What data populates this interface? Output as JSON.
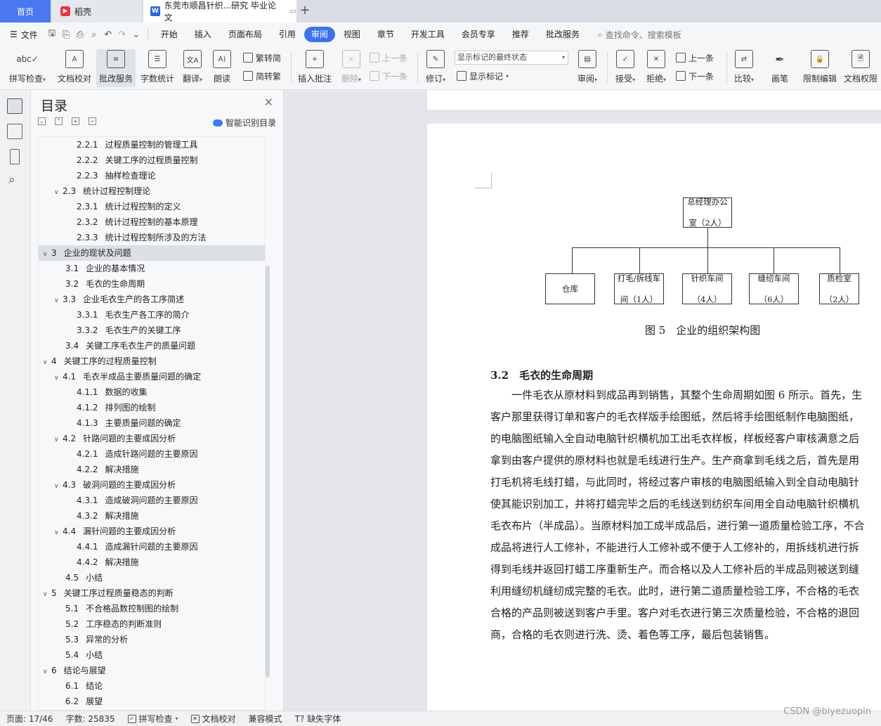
{
  "tabs": {
    "home": "首页",
    "daoke": "稻壳",
    "doc": "东莞市顺昌针织...研究 毕业论文",
    "add": "+"
  },
  "menu": {
    "file": "文件",
    "items": [
      "开始",
      "插入",
      "页面布局",
      "引用",
      "审阅",
      "视图",
      "章节",
      "开发工具",
      "会员专享",
      "推荐",
      "批改服务"
    ],
    "active": "审阅",
    "search": "查找命令、搜索模板"
  },
  "ribbon": {
    "spell": "拼写检查",
    "proofread": "文档校对",
    "correct": "批改服务",
    "wordcount": "字数统计",
    "translate": "翻译",
    "read": "朗读",
    "to_trad": "繁转简",
    "to_simp": "简转繁",
    "insert_comment": "插入批注",
    "delete": "删除",
    "prev": "上一条",
    "next": "下一条",
    "revise": "修订",
    "markup_state": "显示标记的最终状态",
    "show_markup": "显示标记",
    "review": "审阅",
    "accept": "接受",
    "reject": "拒绝",
    "prev2": "上一条",
    "next2": "下一条",
    "compare": "比较",
    "pen": "画笔",
    "restrict": "限制编辑",
    "permission": "文档权限"
  },
  "toc": {
    "title": "目录",
    "smart": "智能识别目录",
    "items": [
      {
        "num": "2.2.1",
        "text": "过程质量控制的管理工具",
        "level": 3,
        "arrow": ""
      },
      {
        "num": "2.2.2",
        "text": "关键工序的过程质量控制",
        "level": 3,
        "arrow": ""
      },
      {
        "num": "2.2.3",
        "text": "抽样检查理论",
        "level": 3,
        "arrow": ""
      },
      {
        "num": "2.3",
        "text": "统计过程控制理论",
        "level": 2,
        "arrow": "∨"
      },
      {
        "num": "2.3.1",
        "text": "统计过程控制的定义",
        "level": 3,
        "arrow": ""
      },
      {
        "num": "2.3.2",
        "text": "统计过程控制的基本原理",
        "level": 3,
        "arrow": ""
      },
      {
        "num": "2.3.3",
        "text": "统计过程控制所涉及的方法",
        "level": 3,
        "arrow": ""
      },
      {
        "num": "3",
        "text": "企业的现状及问题",
        "level": 1,
        "arrow": "∨",
        "selected": true
      },
      {
        "num": "3.1",
        "text": "企业的基本情况",
        "level": 2,
        "arrow": ""
      },
      {
        "num": "3.2",
        "text": "毛衣的生命周期",
        "level": 2,
        "arrow": ""
      },
      {
        "num": "3.3",
        "text": "企业毛衣生产的各工序简述",
        "level": 2,
        "arrow": "∨"
      },
      {
        "num": "3.3.1",
        "text": "毛衣生产各工序的简介",
        "level": 3,
        "arrow": ""
      },
      {
        "num": "3.3.2",
        "text": "毛衣生产的关键工序",
        "level": 3,
        "arrow": ""
      },
      {
        "num": "3.4",
        "text": "关键工序毛衣生产的质量问题",
        "level": 2,
        "arrow": ""
      },
      {
        "num": "4",
        "text": "关键工序的过程质量控制",
        "level": 1,
        "arrow": "∨"
      },
      {
        "num": "4.1",
        "text": "毛衣半成品主要质量问题的确定",
        "level": 2,
        "arrow": "∨"
      },
      {
        "num": "4.1.1",
        "text": "数据的收集",
        "level": 3,
        "arrow": ""
      },
      {
        "num": "4.1.2",
        "text": "排列图的绘制",
        "level": 3,
        "arrow": ""
      },
      {
        "num": "4.1.3",
        "text": "主要质量问题的确定",
        "level": 3,
        "arrow": ""
      },
      {
        "num": "4.2",
        "text": "针路问题的主要成因分析",
        "level": 2,
        "arrow": "∨"
      },
      {
        "num": "4.2.1",
        "text": "造成针路问题的主要原因",
        "level": 3,
        "arrow": ""
      },
      {
        "num": "4.2.2",
        "text": "解决措施",
        "level": 3,
        "arrow": ""
      },
      {
        "num": "4.3",
        "text": "破洞问题的主要成因分析",
        "level": 2,
        "arrow": "∨"
      },
      {
        "num": "4.3.1",
        "text": "造成破洞问题的主要原因",
        "level": 3,
        "arrow": ""
      },
      {
        "num": "4.3.2",
        "text": "解决措施",
        "level": 3,
        "arrow": ""
      },
      {
        "num": "4.4",
        "text": "漏针问题的主要成因分析",
        "level": 2,
        "arrow": "∨"
      },
      {
        "num": "4.4.1",
        "text": "造成漏针问题的主要原因",
        "level": 3,
        "arrow": ""
      },
      {
        "num": "4.4.2",
        "text": "解决措施",
        "level": 3,
        "arrow": ""
      },
      {
        "num": "4.5",
        "text": "小结",
        "level": 2,
        "arrow": ""
      },
      {
        "num": "5",
        "text": "关键工序过程质量稳态的判断",
        "level": 1,
        "arrow": "∨"
      },
      {
        "num": "5.1",
        "text": "不合格品数控制图的绘制",
        "level": 2,
        "arrow": ""
      },
      {
        "num": "5.2",
        "text": "工序稳态的判断准则",
        "level": 2,
        "arrow": ""
      },
      {
        "num": "5.3",
        "text": "异常的分析",
        "level": 2,
        "arrow": ""
      },
      {
        "num": "5.4",
        "text": "小结",
        "level": 2,
        "arrow": ""
      },
      {
        "num": "6",
        "text": "结论与展望",
        "level": 1,
        "arrow": "∨"
      },
      {
        "num": "6.1",
        "text": "结论",
        "level": 2,
        "arrow": ""
      },
      {
        "num": "6.2",
        "text": "展望",
        "level": 2,
        "arrow": ""
      }
    ]
  },
  "document": {
    "org_top": [
      "总经理办公",
      "室（2人）"
    ],
    "org_children": [
      [
        "仓库"
      ],
      [
        "打毛/拆线车",
        "间（1人）"
      ],
      [
        "针织车间",
        "（4人）"
      ],
      [
        "缝纫车间",
        "（6人）"
      ],
      [
        "质检室",
        "（2人）"
      ]
    ],
    "figure_caption": "图 5　企业的组织架构图",
    "section_heading": "3.2　毛衣的生命周期",
    "paragraph_lines": [
      "　　一件毛衣从原材料到成品再到销售，其整个生命周期如图 6 所示。首先，生",
      "客户那里获得订单和客户的毛衣样版手绘图纸，然后将手绘图纸制作电脑图纸，",
      "的电脑图纸输入全自动电脑针织横机加工出毛衣样板，样板经客户审核满意之后",
      "拿到由客户提供的原材料也就是毛线进行生产。生产商拿到毛线之后，首先是用",
      "打毛机将毛线打蜡，与此同时，将经过客户审核的电脑图纸输入到全自动电脑针",
      "使其能识别加工，并将打蜡完毕之后的毛线送到纺织车间用全自动电脑针织横机",
      "毛衣布片（半成品）。当原材料加工成半成品后，进行第一道质量检验工序，不合",
      "成品将进行人工修补，不能进行人工修补或不便于人工修补的，用拆线机进行拆",
      "得到毛线并返回打蜡工序重新生产。而合格以及人工修补后的半成品则被送到缝",
      "利用缝纫机缝纫成完整的毛衣。此时，进行第二道质量检验工序，不合格的毛衣",
      "合格的产品则被送到客户手里。客户对毛衣进行第三次质量检验，不合格的退回",
      "商，合格的毛衣则进行洗、烫、着色等工序，最后包装销售。"
    ]
  },
  "status": {
    "page": "页面: 17/46",
    "words": "字数: 25835",
    "spell": "拼写检查",
    "proof": "文档校对",
    "compat": "兼容模式",
    "missing_font": "缺失字体"
  },
  "watermark": "CSDN @biyezuopin"
}
